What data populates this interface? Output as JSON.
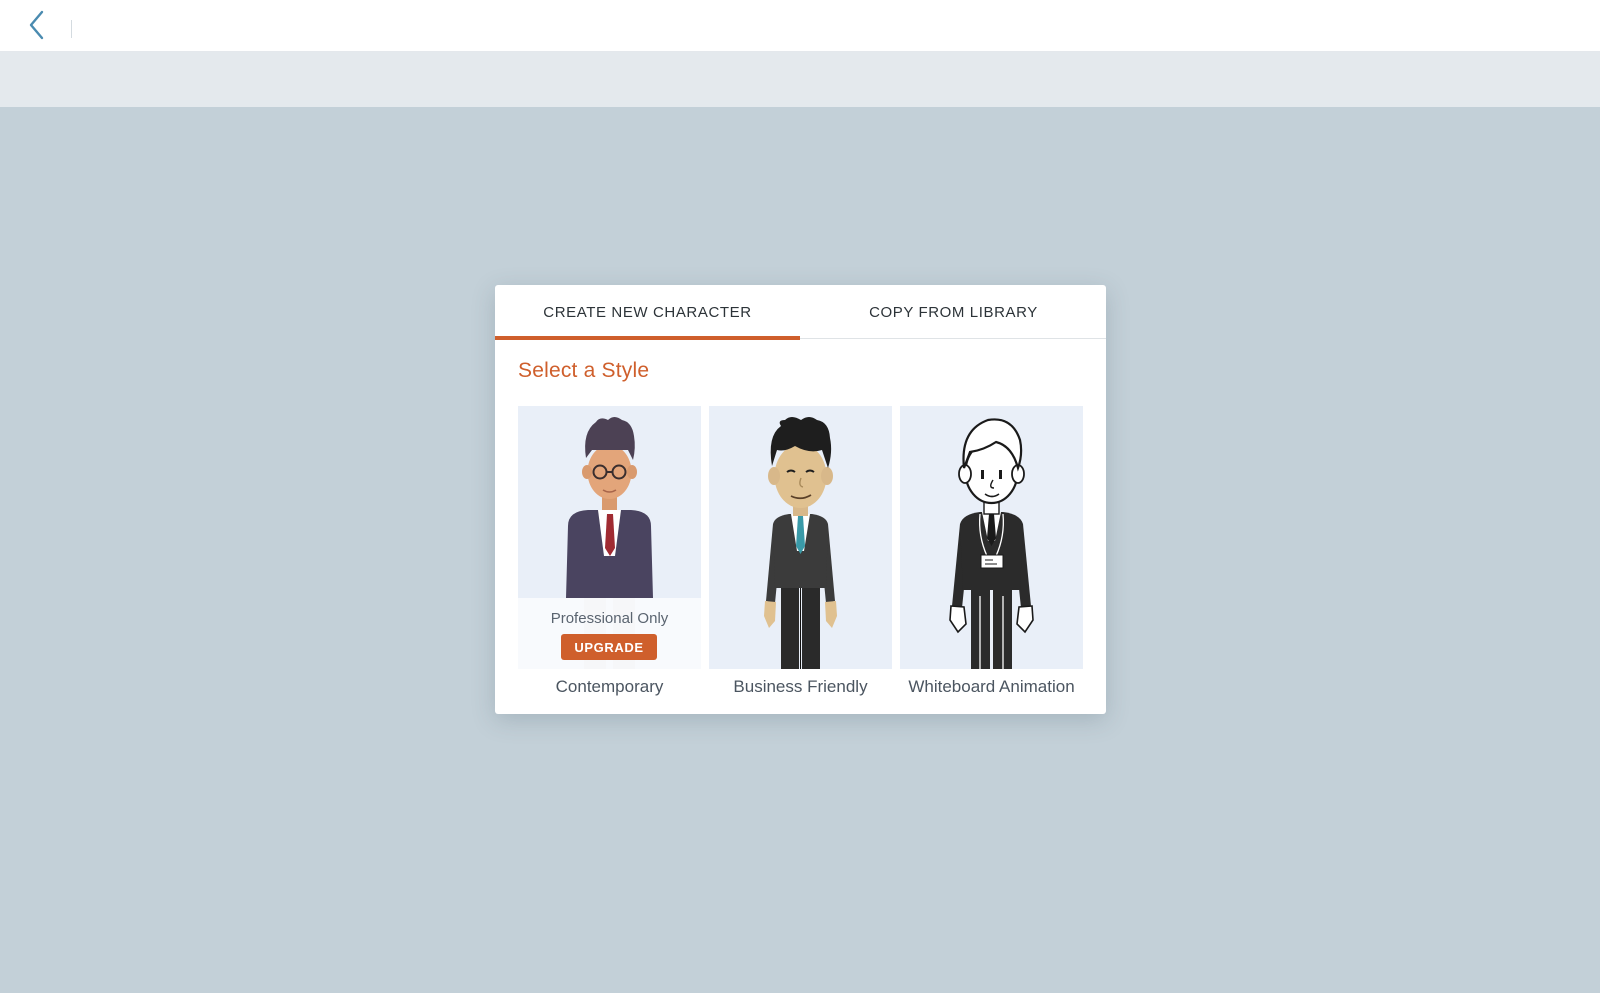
{
  "header": {
    "back_icon": "chevron-left-icon"
  },
  "modal": {
    "tabs": [
      {
        "label": "CREATE NEW CHARACTER",
        "active": true
      },
      {
        "label": "COPY FROM LIBRARY",
        "active": false
      }
    ],
    "section_title": "Select a Style",
    "styles": [
      {
        "label": "Contemporary",
        "locked": true,
        "lock_text": "Professional Only",
        "upgrade_label": "UPGRADE"
      },
      {
        "label": "Business Friendly",
        "locked": false
      },
      {
        "label": "Whiteboard Animation",
        "locked": false
      }
    ]
  },
  "colors": {
    "accent": "#cf5f2c",
    "page_background": "#c3d0d8",
    "card_background": "#e9eff8"
  }
}
